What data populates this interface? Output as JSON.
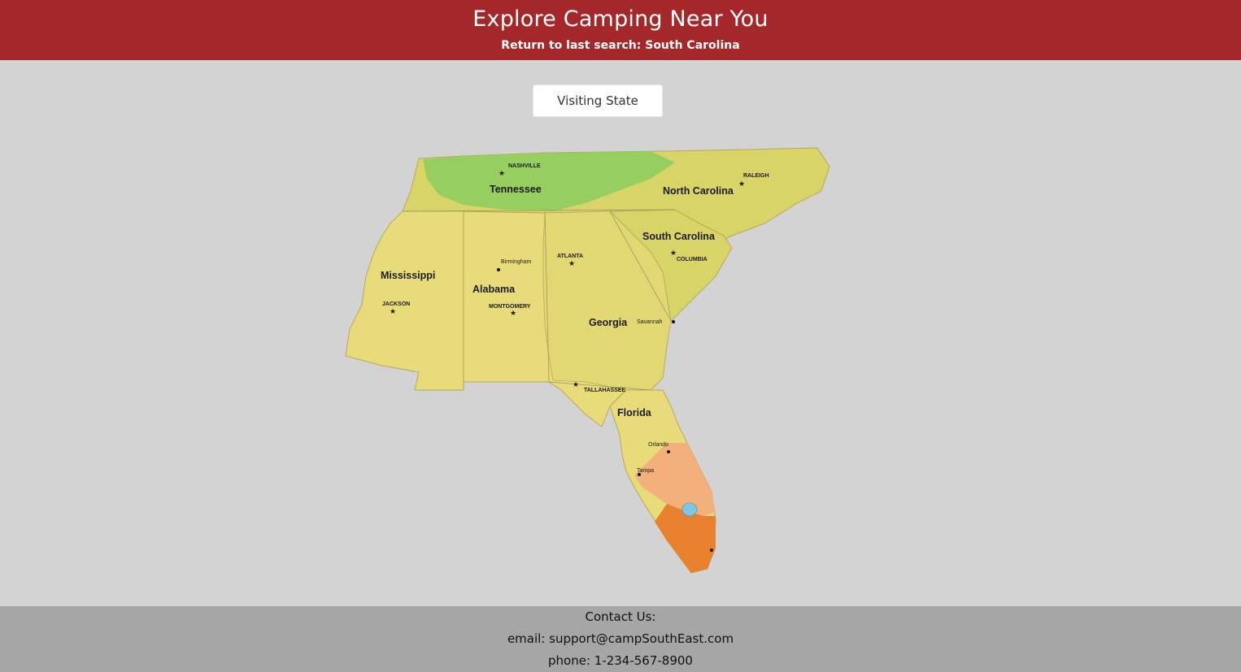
{
  "header": {
    "title": "Explore Camping Near You",
    "return_prefix": "Return to last search: ",
    "return_state": "South Carolina"
  },
  "controls": {
    "visiting_state_label": "Visiting State"
  },
  "map": {
    "states": [
      "Tennessee",
      "North Carolina",
      "South Carolina",
      "Mississippi",
      "Alabama",
      "Georgia",
      "Florida"
    ],
    "cities": [
      "NASHVILLE",
      "RALEIGH",
      "ATLANTA",
      "Birmingham",
      "COLUMBIA",
      "JACKSON",
      "MONTGOMERY",
      "Savannah",
      "TALLAHASSEE",
      "Orlando",
      "Tampa"
    ],
    "colors": {
      "green": "#8fce5e",
      "yellow_green": "#d8d468",
      "yellow": "#ede07f",
      "light_orange": "#f4b07a",
      "orange": "#e8812e",
      "water": "#7fc6e4"
    }
  },
  "footer": {
    "contact_heading": "Contact Us:",
    "email": "email: support@campSouthEast.com",
    "phone": "phone: 1-234-567-8900"
  }
}
